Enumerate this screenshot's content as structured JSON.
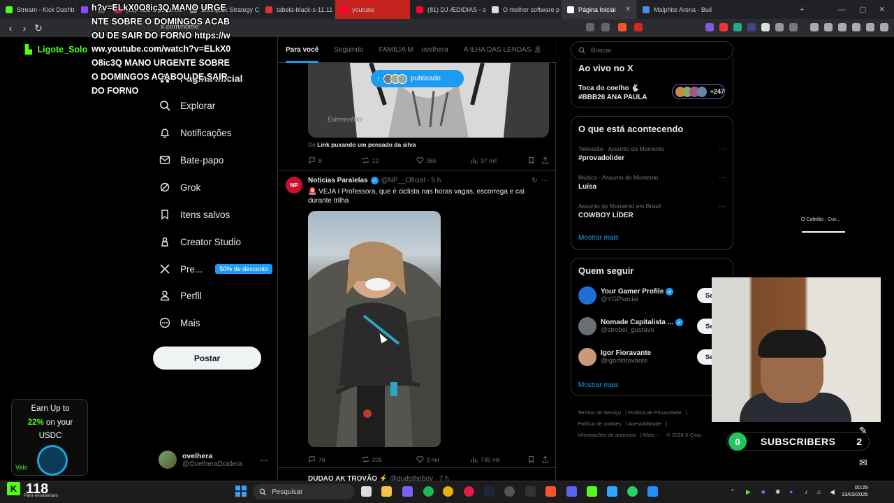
{
  "browser": {
    "tabs": [
      {
        "label": "Stream - Kick Dashbo",
        "color": "#53fc18"
      },
      {
        "label": "",
        "color": "#9146ff"
      },
      {
        "label": "",
        "color": "#555"
      },
      {
        "label": "(81) Vale a pena mo",
        "color": "#ff0033"
      },
      {
        "label": "Blackjack Strategy Ch",
        "color": "#888"
      },
      {
        "label": "tabela-black-s-11.11",
        "color": "#d33"
      },
      {
        "label": "youtube",
        "color": "#ff0033"
      },
      {
        "label": "(81) DJ ÆDIDIAS - ar",
        "color": "#ff0033"
      },
      {
        "label": "O melhor software p",
        "color": "#ddd"
      },
      {
        "label": "Página Inicial",
        "color": "#fff"
      },
      {
        "label": "Malphite Arena - Buil",
        "color": "#4a90e2"
      }
    ],
    "url": "x.com/home"
  },
  "overlay": {
    "chat_text": "h?v=ELkX0O8ic3Q MANO URGENTE SOBRE O DOMINGOS ACABOU DE SAIR DO FORNO https://www.youtube.com/watch?v=ELkX0O8ic3Q MANO URGENTE SOBRE O DOMINGOS ACABOU DE SAIR DO FORNO",
    "username": "Ligote_Solo"
  },
  "sidebar": {
    "items": [
      {
        "label": "Página Inicial"
      },
      {
        "label": "Explorar"
      },
      {
        "label": "Notificações"
      },
      {
        "label": "Bate-papo"
      },
      {
        "label": "Grok"
      },
      {
        "label": "Itens salvos"
      },
      {
        "label": "Creator Studio"
      },
      {
        "label": "Pre..."
      },
      {
        "label": "Perfil"
      },
      {
        "label": "Mais"
      }
    ],
    "premium_badge": "50% de desconto",
    "post_button": "Postar",
    "profile_name": "ovelhera",
    "profile_handle": "@OvelheraDoidera",
    "more": "···"
  },
  "feed": {
    "tabs": [
      "Para você",
      "Seguindo",
      "FAMÍLIA M",
      "ovelhera",
      "A ILHA DAS LENDAS 🏝"
    ],
    "published_pill": "publicado",
    "watermark": "ExtremeBlitz",
    "tweet1": {
      "source_prefix": "De",
      "source": "Link puxando um pensado da silva",
      "replies": "8",
      "reposts": "12",
      "likes": "365",
      "views": "37 mil"
    },
    "tweet2": {
      "avatar": "NP",
      "name": "Notícias Paralelas",
      "handle": "@NP__Oficial · 5 h",
      "text": "🚨 VEJA I Professora, que é ciclista nas horas vagas, escorrega e cai durante trilha",
      "replies": "76",
      "reposts": "205",
      "likes": "3 mil",
      "views": "735 mil"
    },
    "tweet3": {
      "name": "DUDAO AK TROVÃO ⚡",
      "handle": "@dudsthebov · 7 h"
    }
  },
  "right": {
    "search_placeholder": "Buscar",
    "live": {
      "title": "Ao vivo no X",
      "item": "Toca do coelho 🐇 #BBB26 ANA PAULA",
      "count": "+247"
    },
    "trending": {
      "title": "O que está acontecendo",
      "items": [
        {
          "category": "Televisão · Assunto do Momento",
          "name": "#provadolider"
        },
        {
          "category": "Música · Assunto do Momento",
          "name": "Luísa"
        },
        {
          "category": "Assunto do Momento em Brasil",
          "name": "COWBOY LÍDER"
        }
      ],
      "more": "Mostrar mais"
    },
    "who_to_follow": {
      "title": "Quem seguir",
      "items": [
        {
          "name": "Your Gamer Profile",
          "handle": "@YGPsocial",
          "button": "Seguir"
        },
        {
          "name": "Nomade Capitalista ...",
          "handle": "@strobel_gustavo",
          "button": "Seguir"
        },
        {
          "name": "Igor Fioravante",
          "handle": "@igorfioravante",
          "button": "Seguir"
        }
      ],
      "more": "Mostrar mais"
    },
    "footer": [
      "Termos de Serviço",
      "Política de Privacidade",
      "Política de cookies",
      "Acessibilidade",
      "Informações de anúncios",
      "Mais ···",
      "© 2026 X Corp."
    ]
  },
  "stream": {
    "mini_title": "O Cafetão - Cuc...",
    "subs_count": "0",
    "subs_label": "SUBSCRIBERS",
    "subs_right": "2",
    "ad_line1": "Earn Up to",
    "ad_pct": "22%",
    "ad_line2": "on your",
    "ad_line3": "USDC",
    "ad_brand": "Valo",
    "kick_viewers": "118",
    "kick_sub": "Para ensalariado"
  },
  "taskbar": {
    "search": "Pesquisar",
    "time": "00:29",
    "date": "13/03/2026"
  }
}
